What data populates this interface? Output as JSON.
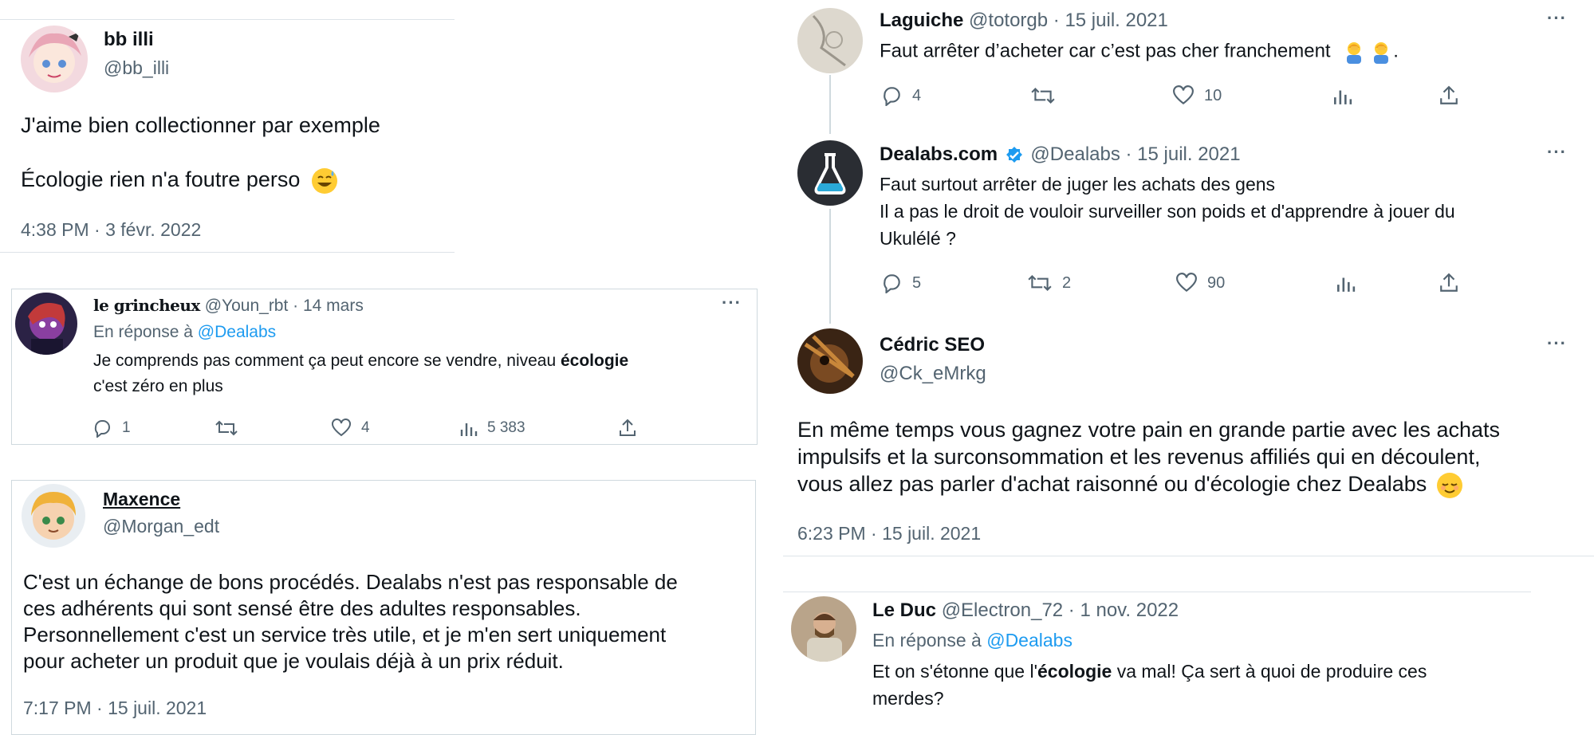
{
  "colors": {
    "link": "#1d9bf0",
    "muted": "#536471",
    "text": "#0f1419",
    "border": "#cfd9de"
  },
  "tweet_bb": {
    "name": "bb illi",
    "handle": "@bb_illi",
    "line1": "J'aime bien collectionner par exemple",
    "line2": "Écologie rien n'a foutre perso",
    "emoji": "sweat-smile-emoji",
    "time": "4:38 PM · 3 févr. 2022"
  },
  "tweet_grincheux": {
    "name": "le grincheux",
    "handle_date": "@Youn_rbt · 14 mars",
    "reply_prefix": "En réponse à",
    "reply_to": "@Dealabs",
    "text_before": "Je comprends pas comment ça peut encore se vendre, niveau ",
    "text_bold": "écologie",
    "text_line2": "c'est zéro en plus",
    "replies": "1",
    "retweets": "",
    "likes": "4",
    "views": "5 383"
  },
  "tweet_maxence": {
    "name": "Maxence",
    "handle": "@Morgan_edt",
    "lines": [
      "C'est un échange de bons procédés. Dealabs n'est pas responsable de",
      "ces adhérents qui sont sensé être des adultes responsables.",
      "Personnellement c'est un service très utile, et je m'en sert uniquement",
      "pour acheter un produit que je voulais déjà à un prix réduit."
    ],
    "time": "7:17 PM · 15 juil. 2021"
  },
  "tweet_laguiche": {
    "name": "Laguiche",
    "handle_date": "@totorgb · 15 juil. 2021",
    "text": "Faut arrêter d’acheter car c’est pas cher franchement",
    "text_end": ".",
    "emoji": "person-facepalming-emoji",
    "replies": "4",
    "retweets": "",
    "likes": "10",
    "views": ""
  },
  "tweet_dealabs": {
    "name": "Dealabs.com",
    "handle_date": "@Dealabs · 15 juil. 2021",
    "lines": [
      "Faut surtout arrêter de juger les achats des gens",
      "Il a pas le droit de vouloir surveiller son poids et d'apprendre à jouer du",
      "Ukulélé ?"
    ],
    "replies": "5",
    "retweets": "2",
    "likes": "90",
    "views": ""
  },
  "tweet_cedric": {
    "name": "Cédric SEO",
    "handle": "@Ck_eMrkg",
    "lines": [
      "En même temps vous gagnez votre pain en grande partie avec les achats",
      "impulsifs et la surconsommation et les revenus affiliés qui en découlent,",
      "vous allez pas parler d'achat raisonné ou d'écologie chez Dealabs"
    ],
    "emoji": "relieved-face-emoji",
    "time": "6:23 PM · 15 juil. 2021"
  },
  "tweet_leduc": {
    "name": "Le Duc",
    "handle_date": "@Electron_72 · 1 nov. 2022",
    "reply_prefix": "En réponse à",
    "reply_to": "@Dealabs",
    "text_before": "Et on s'étonne que l'",
    "text_bold": "écologie",
    "text_after": " va mal! Ça sert à quoi de produire ces",
    "text_line2": "merdes?"
  }
}
